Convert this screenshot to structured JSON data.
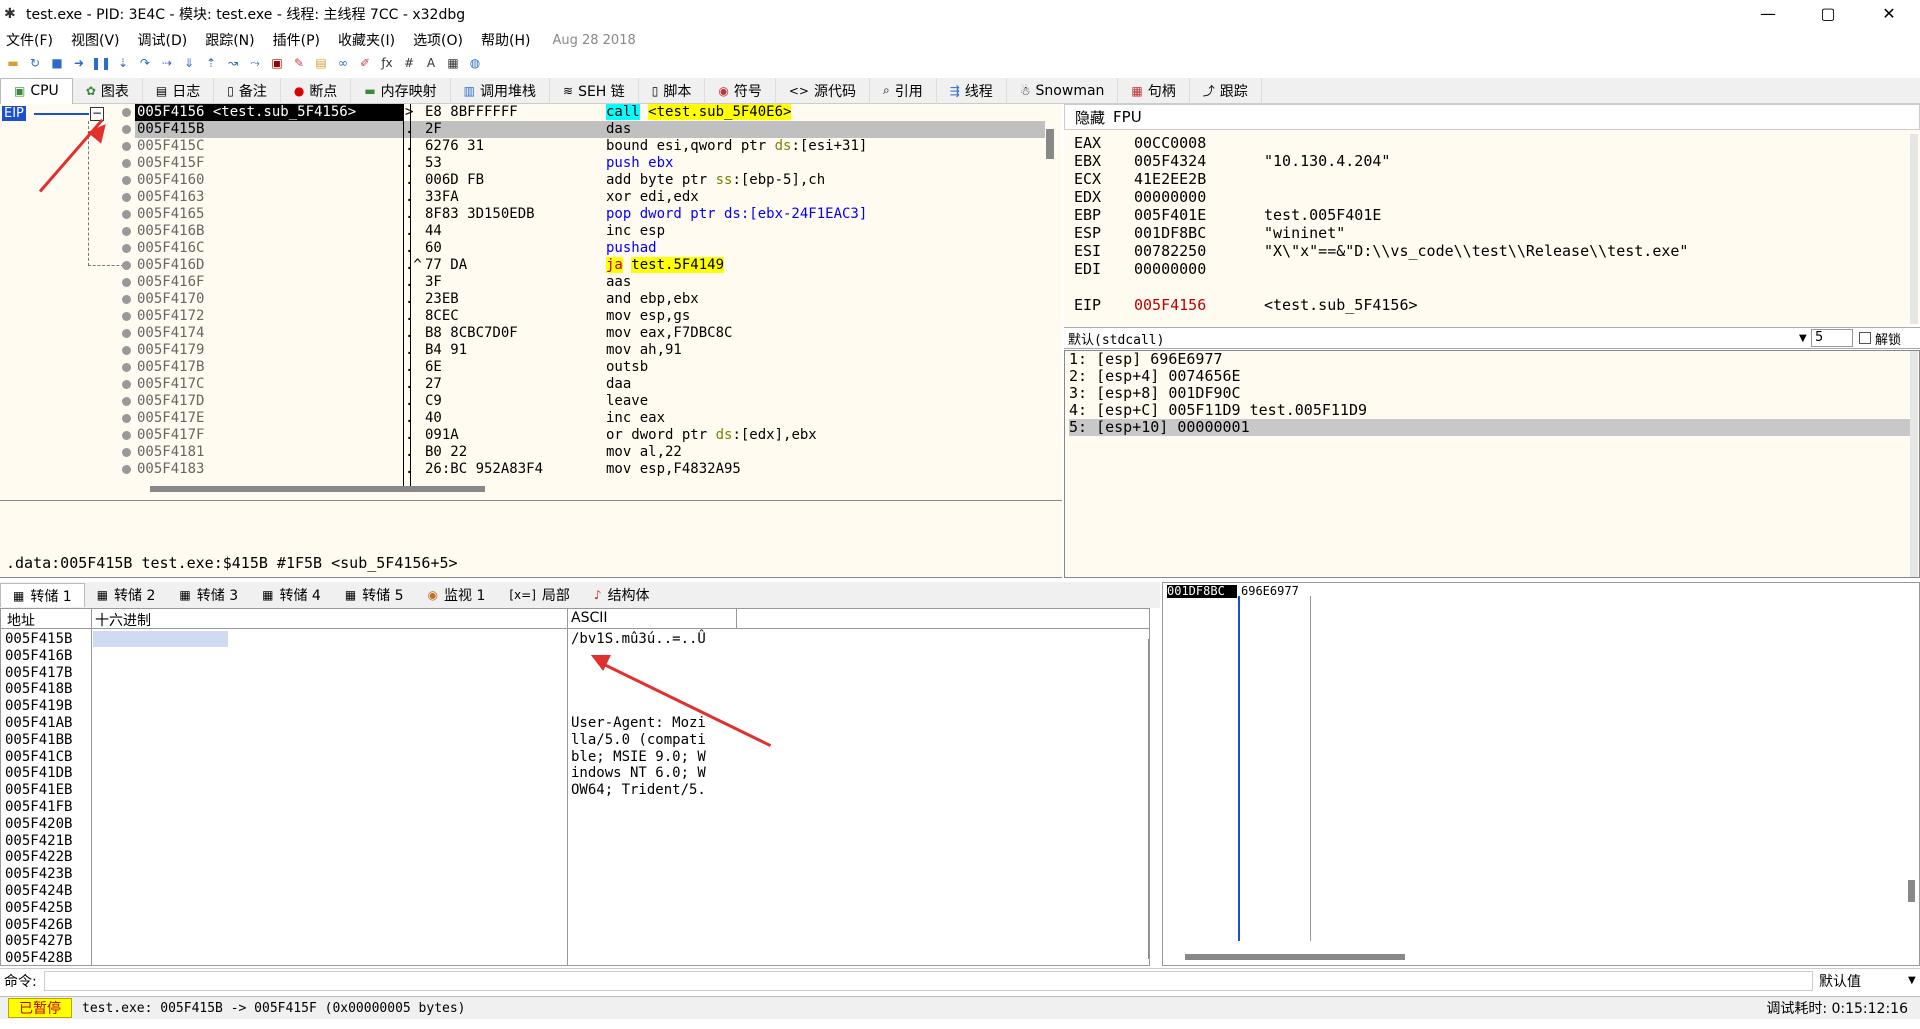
{
  "window": {
    "title": "test.exe - PID: 3E4C - 模块: test.exe - 线程: 主线程 7CC - x32dbg",
    "minimize": "—",
    "maximize": "▢",
    "close": "✕"
  },
  "menu": {
    "items": [
      "文件(F)",
      "视图(V)",
      "调试(D)",
      "跟踪(N)",
      "插件(P)",
      "收藏夹(I)",
      "选项(O)",
      "帮助(H)"
    ],
    "date": "Aug 28 2018"
  },
  "tabs": [
    {
      "label": "CPU",
      "icon": "cpu-icon"
    },
    {
      "label": "图表",
      "icon": "graph-icon"
    },
    {
      "label": "日志",
      "icon": "log-icon"
    },
    {
      "label": "备注",
      "icon": "notes-icon"
    },
    {
      "label": "断点",
      "icon": "breakpoint-icon"
    },
    {
      "label": "内存映射",
      "icon": "memory-map-icon"
    },
    {
      "label": "调用堆栈",
      "icon": "call-stack-icon"
    },
    {
      "label": "SEH 链",
      "icon": "seh-icon"
    },
    {
      "label": "脚本",
      "icon": "script-icon"
    },
    {
      "label": "符号",
      "icon": "symbol-icon"
    },
    {
      "label": "源代码",
      "icon": "source-icon"
    },
    {
      "label": "引用",
      "icon": "reference-icon"
    },
    {
      "label": "线程",
      "icon": "thread-icon"
    },
    {
      "label": "Snowman",
      "icon": "snowman-icon"
    },
    {
      "label": "句柄",
      "icon": "handle-icon"
    },
    {
      "label": "跟踪",
      "icon": "trace-icon"
    }
  ],
  "cpu": {
    "eip_label": "EIP",
    "collapse": "−",
    "rows": [
      {
        "addr": "005F4156 <test.sub_5F4156>",
        "mark": ">",
        "bytes": "E8 8BFFFFFF",
        "dis": "call <test.sub_5F40E6>"
      },
      {
        "addr": "005F415B",
        "mark": ".",
        "bytes": "2F",
        "dis": "das"
      },
      {
        "addr": "005F415C",
        "mark": ".",
        "bytes": "6276 31",
        "dis": "bound esi,qword ptr ds:[esi+31]"
      },
      {
        "addr": "005F415F",
        "mark": ".",
        "bytes": "53",
        "dis": "push ebx"
      },
      {
        "addr": "005F4160",
        "mark": ".",
        "bytes": "006D FB",
        "dis": "add byte ptr ss:[ebp-5],ch"
      },
      {
        "addr": "005F4163",
        "mark": ".",
        "bytes": "33FA",
        "dis": "xor edi,edx"
      },
      {
        "addr": "005F4165",
        "mark": ".",
        "bytes": "8F83 3D150EDB",
        "dis": "pop dword ptr ds:[ebx-24F1EAC3]"
      },
      {
        "addr": "005F416B",
        "mark": ".",
        "bytes": "44",
        "dis": "inc esp"
      },
      {
        "addr": "005F416C",
        "mark": ".",
        "bytes": "60",
        "dis": "pushad"
      },
      {
        "addr": "005F416D",
        "mark": ".^",
        "bytes": "77 DA",
        "dis": "ja test.5F4149"
      },
      {
        "addr": "005F416F",
        "mark": ".",
        "bytes": "3F",
        "dis": "aas"
      },
      {
        "addr": "005F4170",
        "mark": ".",
        "bytes": "23EB",
        "dis": "and ebp,ebx"
      },
      {
        "addr": "005F4172",
        "mark": ".",
        "bytes": "8CEC",
        "dis": "mov esp,gs"
      },
      {
        "addr": "005F4174",
        "mark": ".",
        "bytes": "B8 8CBC7D0F",
        "dis": "mov eax,F7DBC8C"
      },
      {
        "addr": "005F4179",
        "mark": ".",
        "bytes": "B4 91",
        "dis": "mov ah,91"
      },
      {
        "addr": "005F417B",
        "mark": ".",
        "bytes": "6E",
        "dis": "outsb"
      },
      {
        "addr": "005F417C",
        "mark": ".",
        "bytes": "27",
        "dis": "daa"
      },
      {
        "addr": "005F417D",
        "mark": ".",
        "bytes": "C9",
        "dis": "leave"
      },
      {
        "addr": "005F417E",
        "mark": ".",
        "bytes": "40",
        "dis": "inc eax"
      },
      {
        "addr": "005F417F",
        "mark": ".",
        "bytes": "091A",
        "dis": "or dword ptr ds:[edx],ebx"
      },
      {
        "addr": "005F4181",
        "mark": ".",
        "bytes": "B0 22",
        "dis": "mov al,22"
      },
      {
        "addr": "005F4183",
        "mark": ".",
        "bytes": "26:BC 952A83F4",
        "dis": "mov esp,F4832A95"
      }
    ],
    "info": ".data:005F415B test.exe:$415B #1F5B <sub_5F4156+5>"
  },
  "registers": {
    "header": [
      "隐藏",
      "FPU"
    ],
    "rows": [
      {
        "name": "EAX",
        "value": "00CC0008",
        "comment": ""
      },
      {
        "name": "EBX",
        "value": "005F4324",
        "comment": "\"10.130.4.204\""
      },
      {
        "name": "ECX",
        "value": "41E2EE2B",
        "comment": ""
      },
      {
        "name": "EDX",
        "value": "00000000",
        "comment": ""
      },
      {
        "name": "EBP",
        "value": "005F401E",
        "comment": "test.005F401E"
      },
      {
        "name": "ESP",
        "value": "001DF8BC",
        "comment": "\"wininet\""
      },
      {
        "name": "ESI",
        "value": "00782250",
        "comment": "\"X\\\"x\"==&\"D:\\\\vs_code\\\\test\\\\Release\\\\test.exe\""
      },
      {
        "name": "EDI",
        "value": "00000000",
        "comment": ""
      },
      {
        "name": "EIP",
        "value": "005F4156",
        "comment": "<test.sub_5F4156>"
      }
    ],
    "eip_color": "#c00000"
  },
  "callconv": {
    "label": "默认(stdcall)",
    "count": "5",
    "unlock": "解锁"
  },
  "args": [
    "1: [esp] 696E6977",
    "2: [esp+4] 0074656E",
    "3: [esp+8] 001DF90C",
    "4: [esp+C] 005F11D9 test.005F11D9",
    "5: [esp+10] 00000001"
  ],
  "mem_tabs": [
    {
      "label": "转储 1",
      "icon": "dump-icon"
    },
    {
      "label": "转储 2",
      "icon": "dump-icon"
    },
    {
      "label": "转储 3",
      "icon": "dump-icon"
    },
    {
      "label": "转储 4",
      "icon": "dump-icon"
    },
    {
      "label": "转储 5",
      "icon": "dump-icon"
    },
    {
      "label": "监视 1",
      "icon": "watch-icon"
    },
    {
      "label": "局部",
      "icon": "locals-icon"
    },
    {
      "label": "结构体",
      "icon": "struct-icon"
    }
  ],
  "dump": {
    "headers": [
      "地址",
      "十六进制",
      "ASCII"
    ],
    "rows": [
      {
        "addr": "005F415B",
        "hex": "",
        "ascii": "/bv1S.mû3ú..=..Û"
      },
      {
        "addr": "005F416B",
        "hex": "",
        "ascii": ""
      },
      {
        "addr": "005F417B",
        "hex": "",
        "ascii": ""
      },
      {
        "addr": "005F418B",
        "hex": "",
        "ascii": ""
      },
      {
        "addr": "005F419B",
        "hex": "",
        "ascii": ""
      },
      {
        "addr": "005F41AB",
        "hex": "",
        "ascii": "User-Agent: Mozi"
      },
      {
        "addr": "005F41BB",
        "hex": "",
        "ascii": "lla/5.0 (compati"
      },
      {
        "addr": "005F41CB",
        "hex": "",
        "ascii": "ble; MSIE 9.0; W"
      },
      {
        "addr": "005F41DB",
        "hex": "",
        "ascii": "indows NT 6.0; W"
      },
      {
        "addr": "005F41EB",
        "hex": "",
        "ascii": "OW64; Trident/5."
      },
      {
        "addr": "005F41FB",
        "hex": "",
        "ascii": ""
      },
      {
        "addr": "005F420B",
        "hex": "",
        "ascii": ""
      },
      {
        "addr": "005F421B",
        "hex": "",
        "ascii": ""
      },
      {
        "addr": "005F422B",
        "hex": "",
        "ascii": ""
      },
      {
        "addr": "005F423B",
        "hex": "",
        "ascii": ""
      },
      {
        "addr": "005F424B",
        "hex": "",
        "ascii": ""
      },
      {
        "addr": "005F425B",
        "hex": "",
        "ascii": ""
      },
      {
        "addr": "005F426B",
        "hex": "",
        "ascii": ""
      },
      {
        "addr": "005F427B",
        "hex": "",
        "ascii": ""
      },
      {
        "addr": "005F428B",
        "hex": "",
        "ascii": ""
      }
    ]
  },
  "stack": {
    "rows": [
      {
        "addr": "001DF8BC",
        "value": "696E6977",
        "comment": "",
        "type": ""
      },
      {
        "addr": "",
        "value": "",
        "comment": "",
        "type": ""
      },
      {
        "addr": "",
        "value": "",
        "comment": "",
        "type": ""
      },
      {
        "addr": "",
        "value": "",
        "comment": "",
        "type": ""
      },
      {
        "addr": "",
        "value": "",
        "comment": "",
        "type": ""
      },
      {
        "addr": "",
        "value": "",
        "comment": "",
        "type": ""
      },
      {
        "addr": "",
        "value": "",
        "comment": "",
        "type": ""
      },
      {
        "addr": "",
        "value": "",
        "comment": "",
        "type": ""
      },
      {
        "addr": "",
        "value": "",
        "comment": "",
        "type": ""
      },
      {
        "addr": "",
        "value": "",
        "comment": "",
        "type": ""
      },
      {
        "addr": "",
        "value": "",
        "comment": "",
        "type": ""
      },
      {
        "addr": "",
        "value": "",
        "comment": "",
        "type": ""
      },
      {
        "addr": "",
        "value": "",
        "comment": "",
        "type": ""
      },
      {
        "addr": "",
        "value": "",
        "comment": "",
        "type": ""
      },
      {
        "addr": "",
        "value": "",
        "comment": "",
        "type": ""
      },
      {
        "addr": "",
        "value": "",
        "comment": "",
        "type": ""
      },
      {
        "addr": "",
        "value": "",
        "comment": "",
        "type": ""
      },
      {
        "addr": "",
        "value": "",
        "comment": "",
        "type": ""
      },
      {
        "addr": "",
        "value": "",
        "comment": "",
        "type": ""
      },
      {
        "addr": "",
        "value": "",
        "comment": "",
        "type": ""
      },
      {
        "addr": "",
        "value": "",
        "comment": "",
        "type": ""
      },
      {
        "addr": "",
        "value": "",
        "comment": "",
        "type": ""
      },
      {
        "addr": "",
        "value": "",
        "comment": "",
        "type": ""
      },
      {
        "addr": "",
        "value": "",
        "comment": "",
        "type": ""
      },
      {
        "addr": "",
        "value": "",
        "comment": "",
        "type": ""
      },
      {
        "addr": "",
        "value": "",
        "comment": "",
        "type": ""
      },
      {
        "addr": "",
        "value": "",
        "comment": "",
        "type": ""
      },
      {
        "addr": "",
        "value": "",
        "comment": "",
        "type": ""
      }
    ]
  },
  "cmd": {
    "label": "命令:",
    "default": "默认值"
  },
  "status": {
    "paused": "已暂停",
    "message": "test.exe: 005F415B -> 005F415F (0x00000005 bytes)",
    "timing": "调试耗时: 0:15:12:16"
  }
}
